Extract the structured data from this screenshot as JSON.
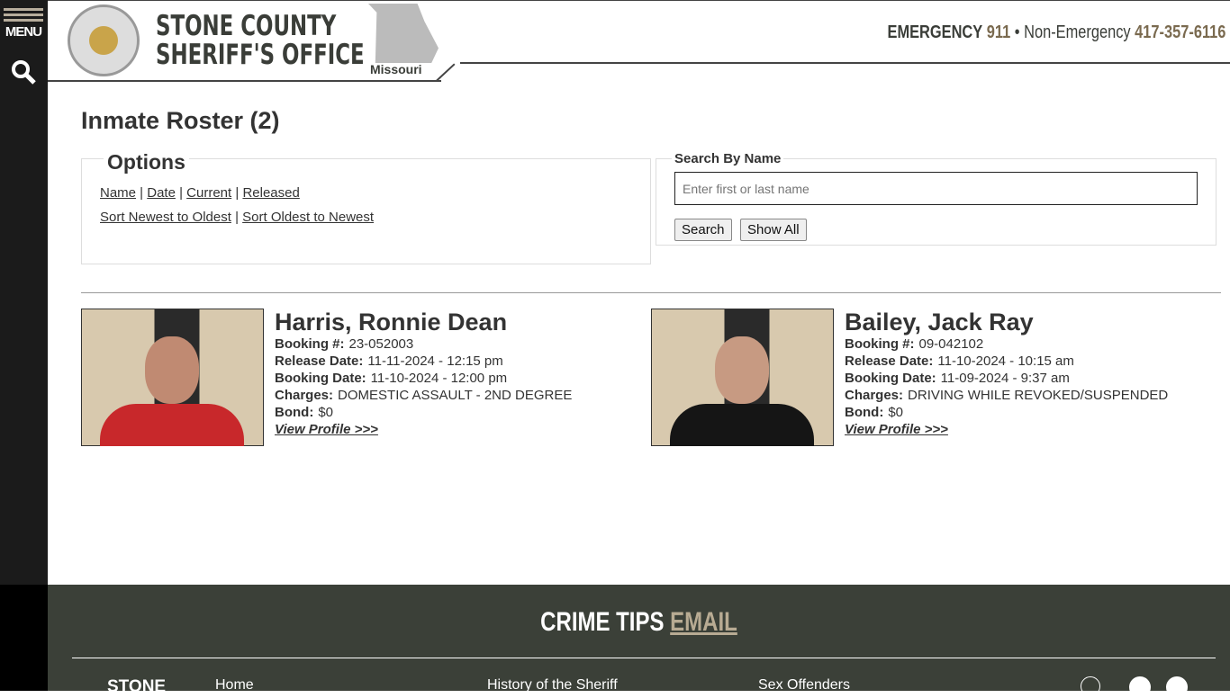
{
  "sidebar": {
    "menu_label": "MENU"
  },
  "header": {
    "title_line1": "STONE COUNTY",
    "title_line2": "SHERIFF'S OFFICE",
    "map_label": "Missouri",
    "emergency_label": "EMERGENCY",
    "emergency_number": "911",
    "separator": "•",
    "nonemergency_label": "Non-Emergency",
    "nonemergency_number": "417-357-6116"
  },
  "page": {
    "title": "Inmate Roster (2)"
  },
  "options": {
    "legend": "Options",
    "filters": [
      "Name",
      "Date",
      "Current",
      "Released"
    ],
    "sorts": [
      "Sort Newest to Oldest",
      "Sort Oldest to Newest"
    ]
  },
  "search": {
    "legend": "Search By Name",
    "placeholder": "Enter first or last name",
    "search_label": "Search",
    "show_all_label": "Show All"
  },
  "labels": {
    "booking": "Booking #:",
    "release": "Release Date:",
    "booking_date": "Booking Date:",
    "charges": "Charges:",
    "bond": "Bond:",
    "view": "View Profile >>>"
  },
  "inmates": [
    {
      "name": "Harris, Ronnie Dean",
      "booking": "23-052003",
      "release": "11-11-2024 - 12:15 pm",
      "booking_date": "11-10-2024 - 12:00 pm",
      "charges": "DOMESTIC ASSAULT - 2ND DEGREE",
      "bond": "$0",
      "shirt": "#c8282b"
    },
    {
      "name": "Bailey, Jack Ray",
      "booking": "09-042102",
      "release": "11-10-2024 - 10:15 am",
      "booking_date": "11-09-2024 - 9:37 am",
      "charges": "DRIVING WHILE REVOKED/SUSPENDED",
      "bond": "$0",
      "shirt": "#151515"
    }
  ],
  "footer": {
    "crime_tips": "CRIME TIPS",
    "email": "EMAIL",
    "logo_text": "STONE",
    "links": [
      "Home",
      "History of the Sheriff",
      "Sex Offenders"
    ]
  }
}
